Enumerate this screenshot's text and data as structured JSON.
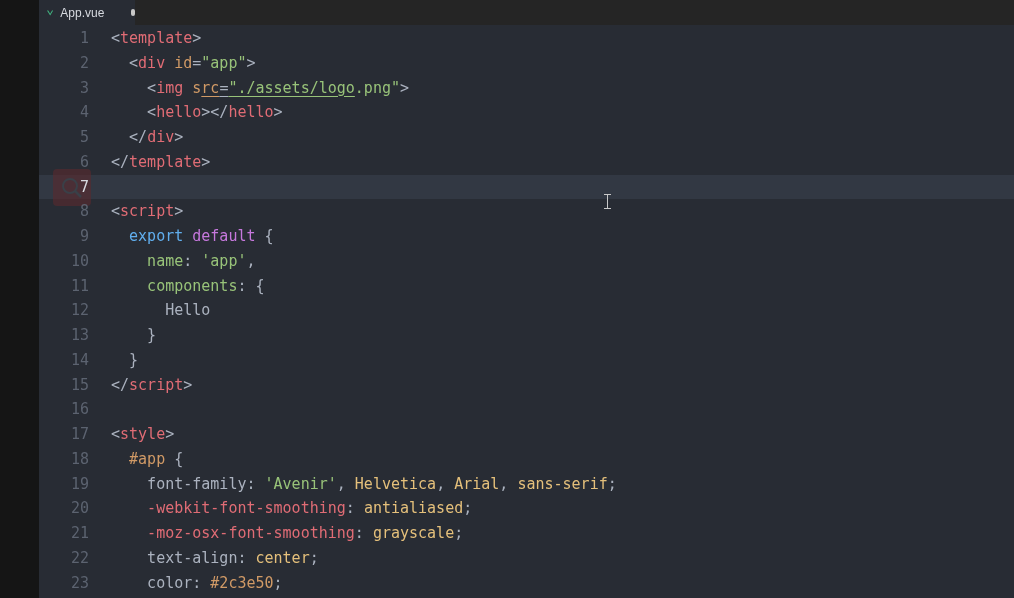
{
  "tab": {
    "title": "App.vue",
    "modified": true,
    "selected": true
  },
  "lines": [
    {
      "number": "1",
      "current": false,
      "tokens": [
        {
          "text": "<",
          "kind": "punct"
        },
        {
          "text": "template",
          "kind": "tag"
        },
        {
          "text": ">",
          "kind": "punct"
        }
      ]
    },
    {
      "number": "2",
      "current": false,
      "tokens": [
        {
          "text": "  <",
          "kind": "punct"
        },
        {
          "text": "div",
          "kind": "tag"
        },
        {
          "text": " id",
          "kind": "attr"
        },
        {
          "text": "=",
          "kind": "punct"
        },
        {
          "text": "\"app\"",
          "kind": "string"
        },
        {
          "text": ">",
          "kind": "punct"
        }
      ]
    },
    {
      "number": "3",
      "current": false,
      "tokens": [
        {
          "text": "    <",
          "kind": "punct"
        },
        {
          "text": "img",
          "kind": "tag"
        },
        {
          "text": " s",
          "kind": "attr"
        },
        {
          "text": "rc",
          "kind": "attr",
          "underline": true
        },
        {
          "text": "=",
          "kind": "punct",
          "underline": true
        },
        {
          "text": "\"./assets/logo",
          "kind": "string",
          "underline": true
        },
        {
          "text": ".png\"",
          "kind": "string"
        },
        {
          "text": ">",
          "kind": "punct"
        }
      ]
    },
    {
      "number": "4",
      "current": false,
      "tokens": [
        {
          "text": "    <",
          "kind": "punct"
        },
        {
          "text": "hello",
          "kind": "tag"
        },
        {
          "text": "></",
          "kind": "punct"
        },
        {
          "text": "hello",
          "kind": "tag"
        },
        {
          "text": ">",
          "kind": "punct"
        }
      ]
    },
    {
      "number": "5",
      "current": false,
      "tokens": [
        {
          "text": "  </",
          "kind": "punct"
        },
        {
          "text": "div",
          "kind": "tag"
        },
        {
          "text": ">",
          "kind": "punct"
        }
      ]
    },
    {
      "number": "6",
      "current": false,
      "tokens": [
        {
          "text": "</",
          "kind": "punct"
        },
        {
          "text": "template",
          "kind": "tag"
        },
        {
          "text": ">",
          "kind": "punct"
        }
      ]
    },
    {
      "number": "7",
      "current": true
    },
    {
      "number": "8",
      "current": false,
      "tokens": [
        {
          "text": "<",
          "kind": "punct"
        },
        {
          "text": "script",
          "kind": "tag"
        },
        {
          "text": ">",
          "kind": "punct"
        }
      ]
    },
    {
      "number": "9",
      "current": false,
      "tokens": [
        {
          "text": "  export",
          "kind": "keyword"
        },
        {
          "text": " default",
          "kind": "keyword2"
        },
        {
          "text": " {",
          "kind": "punct"
        }
      ]
    },
    {
      "number": "10",
      "current": false,
      "tokens": [
        {
          "text": "    name",
          "kind": "property"
        },
        {
          "text": ": ",
          "kind": "punct"
        },
        {
          "text": "'app'",
          "kind": "string"
        },
        {
          "text": ",",
          "kind": "punct"
        }
      ]
    },
    {
      "number": "11",
      "current": false,
      "tokens": [
        {
          "text": "    components",
          "kind": "property"
        },
        {
          "text": ": {",
          "kind": "punct"
        }
      ]
    },
    {
      "number": "12",
      "current": false,
      "tokens": [
        {
          "text": "      Hello",
          "kind": "plain"
        }
      ]
    },
    {
      "number": "13",
      "current": false,
      "tokens": [
        {
          "text": "    }",
          "kind": "punct"
        }
      ]
    },
    {
      "number": "14",
      "current": false,
      "tokens": [
        {
          "text": "  }",
          "kind": "punct"
        }
      ]
    },
    {
      "number": "15",
      "current": false,
      "tokens": [
        {
          "text": "</",
          "kind": "punct"
        },
        {
          "text": "script",
          "kind": "tag"
        },
        {
          "text": ">",
          "kind": "punct"
        }
      ]
    },
    {
      "number": "16",
      "current": false
    },
    {
      "number": "17",
      "current": false,
      "tokens": [
        {
          "text": "<",
          "kind": "punct"
        },
        {
          "text": "style",
          "kind": "tag"
        },
        {
          "text": ">",
          "kind": "punct"
        }
      ]
    },
    {
      "number": "18",
      "current": false,
      "tokens": [
        {
          "text": "  #app",
          "kind": "selector"
        },
        {
          "text": " {",
          "kind": "punct"
        }
      ]
    },
    {
      "number": "19",
      "current": false,
      "tokens": [
        {
          "text": "    font-family",
          "kind": "plain"
        },
        {
          "text": ": ",
          "kind": "punct"
        },
        {
          "text": "'Avenir'",
          "kind": "string"
        },
        {
          "text": ", ",
          "kind": "punct"
        },
        {
          "text": "Helvetica",
          "kind": "value"
        },
        {
          "text": ", ",
          "kind": "punct"
        },
        {
          "text": "Arial",
          "kind": "value"
        },
        {
          "text": ", ",
          "kind": "punct"
        },
        {
          "text": "sans-serif",
          "kind": "value"
        },
        {
          "text": ";",
          "kind": "punct"
        }
      ]
    },
    {
      "number": "20",
      "current": false,
      "tokens": [
        {
          "text": "    -webkit-font-smoothing",
          "kind": "vendor"
        },
        {
          "text": ": ",
          "kind": "punct"
        },
        {
          "text": "antialiased",
          "kind": "value"
        },
        {
          "text": ";",
          "kind": "punct"
        }
      ]
    },
    {
      "number": "21",
      "current": false,
      "tokens": [
        {
          "text": "    -moz-osx-font-smoothing",
          "kind": "vendor"
        },
        {
          "text": ": ",
          "kind": "punct"
        },
        {
          "text": "grayscale",
          "kind": "value"
        },
        {
          "text": ";",
          "kind": "punct"
        }
      ]
    },
    {
      "number": "22",
      "current": false,
      "tokens": [
        {
          "text": "    text-align",
          "kind": "plain"
        },
        {
          "text": ": ",
          "kind": "punct"
        },
        {
          "text": "center",
          "kind": "value"
        },
        {
          "text": ";",
          "kind": "punct"
        }
      ]
    },
    {
      "number": "23",
      "current": false,
      "tokens": [
        {
          "text": "    color",
          "kind": "plain"
        },
        {
          "text": ": ",
          "kind": "punct"
        },
        {
          "text": "#2c3e50",
          "kind": "selector"
        },
        {
          "text": ";",
          "kind": "punct"
        }
      ]
    }
  ]
}
